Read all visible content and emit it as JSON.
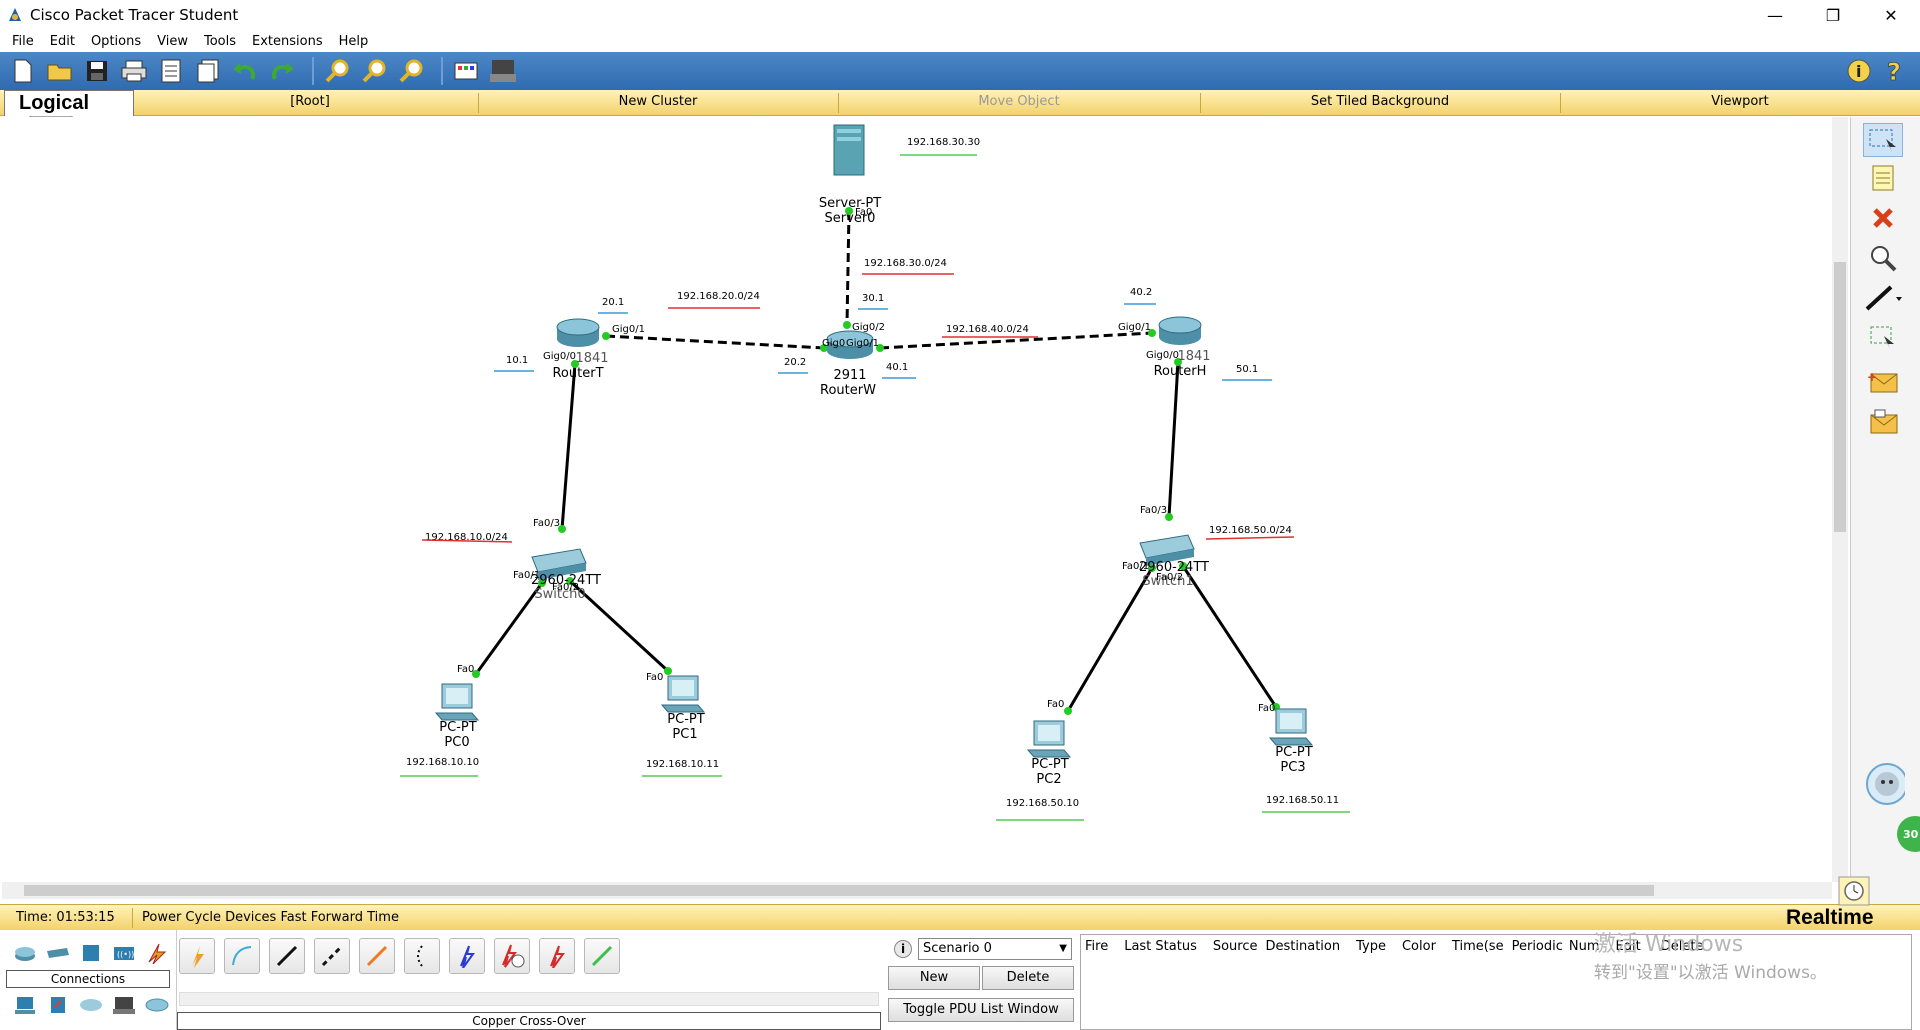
{
  "window": {
    "title": "Cisco Packet Tracer Student",
    "controls": [
      "—",
      "❐",
      "✕"
    ]
  },
  "menu": [
    "File",
    "Edit",
    "Options",
    "View",
    "Tools",
    "Extensions",
    "Help"
  ],
  "logical_bar": {
    "tab": "Logical",
    "items": [
      "[Root]",
      "New Cluster",
      "Move Object",
      "Set Tiled Background",
      "Viewport"
    ]
  },
  "topology": {
    "devices": [
      {
        "id": "server0",
        "type_label": "Server-PT",
        "name": "Server0",
        "ip": "192.168.30.30"
      },
      {
        "id": "routerT",
        "type_label": "1841",
        "name": "RouterT"
      },
      {
        "id": "routerW",
        "type_label": "2911",
        "name": "RouterW"
      },
      {
        "id": "routerH",
        "type_label": "1841",
        "name": "RouterH"
      },
      {
        "id": "switch0",
        "type_label": "2960-24TT",
        "name": "Switch0"
      },
      {
        "id": "switch1",
        "type_label": "2960-24TT",
        "name": "Switch1"
      },
      {
        "id": "pc0",
        "type_label": "PC-PT",
        "name": "PC0",
        "ip": "192.168.10.10"
      },
      {
        "id": "pc1",
        "type_label": "PC-PT",
        "name": "PC1",
        "ip": "192.168.10.11"
      },
      {
        "id": "pc2",
        "type_label": "PC-PT",
        "name": "PC2",
        "ip": "192.168.50.10"
      },
      {
        "id": "pc3",
        "type_label": "PC-PT",
        "name": "PC3",
        "ip": "192.168.50.11"
      }
    ],
    "networks": [
      "192.168.30.0/24",
      "192.168.20.0/24",
      "192.168.40.0/24",
      "192.168.10.0/24",
      "192.168.50.0/24"
    ],
    "host_labels": [
      "20.1",
      "30.1",
      "40.2",
      "10.1",
      "20.2",
      "40.1",
      "50.1"
    ],
    "ports": {
      "server0": "Fa0",
      "routerW_top": "Gig0/2",
      "routerW_left": "Gig0",
      "routerW_right": "Gig0/1",
      "routerT_right": "Gig0/1",
      "routerT_bottom": "Gig0/0",
      "routerH_left": "Gig0/1",
      "routerH_bottom": "Gig0/0",
      "switch0_top": "Fa0/3",
      "switch0_left": "Fa0/1",
      "switch0_right": "Fa0/2",
      "switch1_top": "Fa0/3",
      "switch1_left": "Fa0/1",
      "switch1_right": "Fa0/2",
      "pc_port": "Fa0"
    }
  },
  "status": {
    "time": "Time: 01:53:15",
    "actions": "Power Cycle Devices  Fast Forward Time",
    "mode": "Realtime"
  },
  "bottom": {
    "device_category_label": "Connections",
    "cable_label": "Copper Cross-Over",
    "scenario": "Scenario 0",
    "new_label": "New",
    "delete_label": "Delete",
    "toggle_label": "Toggle PDU List Window",
    "pdu_columns": [
      "Fire",
      "Last Status",
      "Source",
      "Destination",
      "Type",
      "Color",
      "Time(se",
      "Periodic",
      "Num",
      "Edit",
      "Delete"
    ]
  },
  "watermark": {
    "line1": "激活 Windows",
    "line2": "转到\"设置\"以激活 Windows。"
  },
  "colors": {
    "toolbar": "#2f6bb0",
    "yellow_bar": "#f3d26b",
    "link_black": "#000000",
    "port_green": "#22cc22",
    "underline_red": "#e03030",
    "underline_blue": "#3a9ad9",
    "underline_green": "#55cc55"
  }
}
